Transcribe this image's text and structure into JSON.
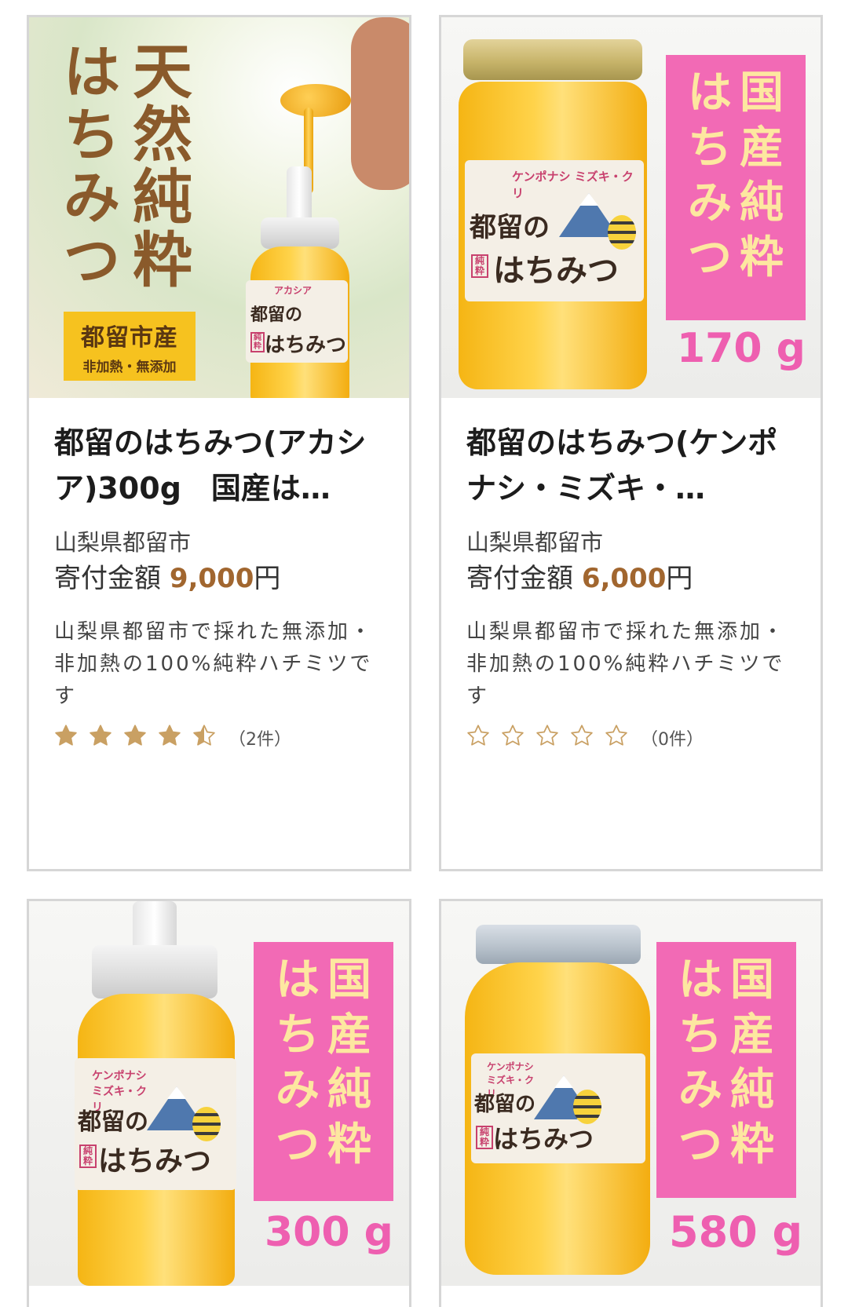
{
  "colors": {
    "accent_price": "#a1662f",
    "star_filled": "#c9a063",
    "star_empty": "#c9a063",
    "card_border": "#d6d6d6",
    "pink_banner": "#f26ab5",
    "banner_text": "#fde7a0",
    "honey": "#f5b514"
  },
  "products": [
    {
      "title": "都留のはちみつ(アカシア)300g　国産は…",
      "municipality": "山梨県都留市",
      "amount_label": "寄付金額",
      "amount": "9,000",
      "amount_unit": "円",
      "description": "山梨県都留市で採れた無添加・非加熱の100%純粋ハチミツです",
      "rating": 4.5,
      "review_count": "（2件）",
      "image": {
        "headline_col1": "天然純粋",
        "headline_col2": "はちみつ",
        "badge_line1": "都留市産",
        "badge_line2": "非加熱・無添加",
        "label_sub": "アカシア",
        "label_line1": "都留の",
        "label_line2": "はちみつ",
        "label_mark": "純粋"
      }
    },
    {
      "title": "都留のはちみつ(ケンポナシ・ミズキ・…",
      "municipality": "山梨県都留市",
      "amount_label": "寄付金額",
      "amount": "6,000",
      "amount_unit": "円",
      "description": "山梨県都留市で採れた無添加・非加熱の100%純粋ハチミツです",
      "rating": 0,
      "review_count": "（0件）",
      "image": {
        "banner_col1": "国産純粋",
        "banner_col2": "はちみつ",
        "weight": "170 g",
        "label_sub": "ケンポナシ ミズキ・クリ",
        "label_line1": "都留の",
        "label_line2": "はちみつ",
        "label_mark": "純粋"
      }
    },
    {
      "image": {
        "banner_col1": "国産純粋",
        "banner_col2": "はちみつ",
        "weight": "300 g",
        "label_sub": "ケンポナシ ミズキ・クリ",
        "label_line1": "都留の",
        "label_line2": "はちみつ",
        "label_mark": "純粋"
      }
    },
    {
      "image": {
        "banner_col1": "国産純粋",
        "banner_col2": "はちみつ",
        "weight": "580 g",
        "label_sub": "ケンポナシ ミズキ・クリ",
        "label_line1": "都留の",
        "label_line2": "はちみつ",
        "label_mark": "純粋"
      }
    }
  ]
}
